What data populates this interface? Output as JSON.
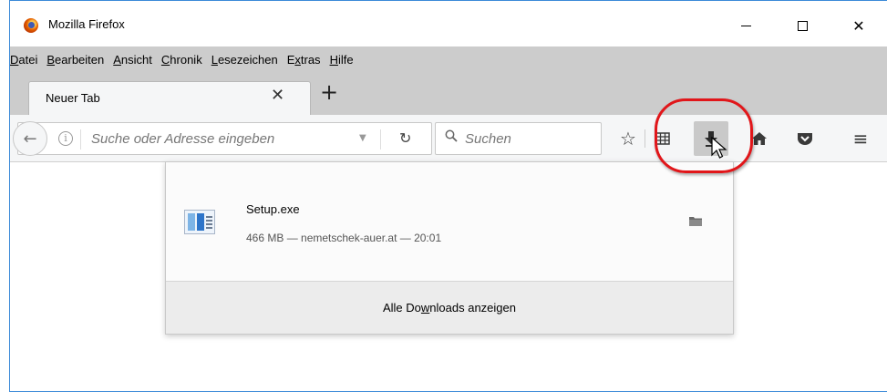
{
  "window": {
    "title": "Mozilla Firefox",
    "minimize_glyph": "—",
    "maximize_glyph": "☐",
    "close_glyph": "✕"
  },
  "menubar": {
    "items": [
      {
        "first": "D",
        "rest": "atei"
      },
      {
        "first": "B",
        "rest": "earbeiten"
      },
      {
        "first": "A",
        "rest": "nsicht"
      },
      {
        "first": "C",
        "rest": "hronik"
      },
      {
        "first": "L",
        "rest": "esezeichen"
      },
      {
        "pre": "E",
        "first": "x",
        "rest": "tras"
      },
      {
        "first": "H",
        "rest": "ilfe"
      }
    ]
  },
  "tabs": {
    "active_label": "Neuer Tab",
    "close_glyph": "✕",
    "new_tab_glyph": "+"
  },
  "navbar": {
    "url_placeholder": "Suche oder Adresse eingeben",
    "search_placeholder": "Suchen",
    "icons": [
      "back-icon",
      "info-icon",
      "dropmarker-icon",
      "reload-icon",
      "search-icon",
      "bookmark-star-icon",
      "library-icon",
      "download-icon",
      "home-icon",
      "pocket-icon",
      "hamburger-menu-icon"
    ]
  },
  "downloads_panel": {
    "item": {
      "file_name": "Setup.exe",
      "meta": "466 MB — nemetschek-auer.at — 20:01"
    },
    "footer": {
      "pre": "Alle Do",
      "underlined": "w",
      "post": "nloads anzeigen"
    }
  },
  "colors": {
    "menubar_bg": "#cccccc",
    "toolbar_bg": "#f5f6f7",
    "highlight_ring": "#e1161a",
    "window_border": "#3c8ad8"
  }
}
